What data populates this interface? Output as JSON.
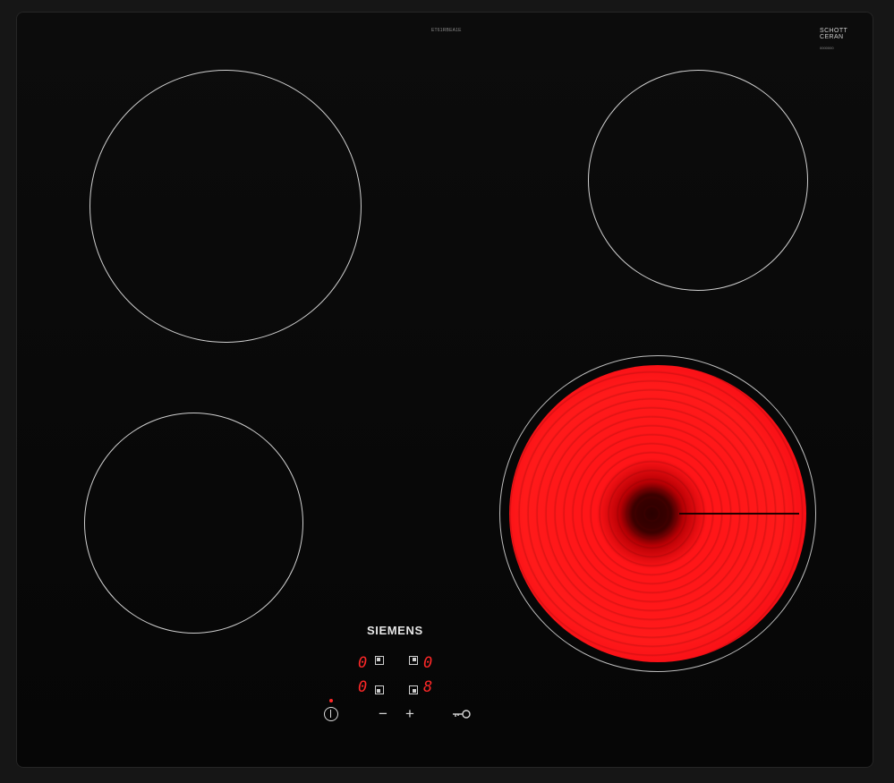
{
  "cooktop": {
    "model_code": "ET61RBEA1E",
    "glass_brand": {
      "line1": "SCHOTT",
      "line2": "CERAN",
      "line3": "0000000"
    },
    "brand": "SIEMENS",
    "active_zone": "front-right",
    "colors": {
      "glass": "#0a0a0a",
      "zone_ring": "#cfcfcf",
      "heat_glow": "#ff1a1a",
      "display": "#ff2828"
    }
  },
  "controls": {
    "displays": [
      "0",
      "0",
      "0",
      "8"
    ],
    "zone_icons": [
      "zone-rear-left-icon",
      "zone-rear-right-icon",
      "zone-front-left-icon",
      "zone-front-right-icon"
    ],
    "buttons": [
      "power-icon",
      "minus-icon",
      "plus-icon",
      "key-lock-icon"
    ],
    "minus_label": "−",
    "plus_label": "+"
  }
}
